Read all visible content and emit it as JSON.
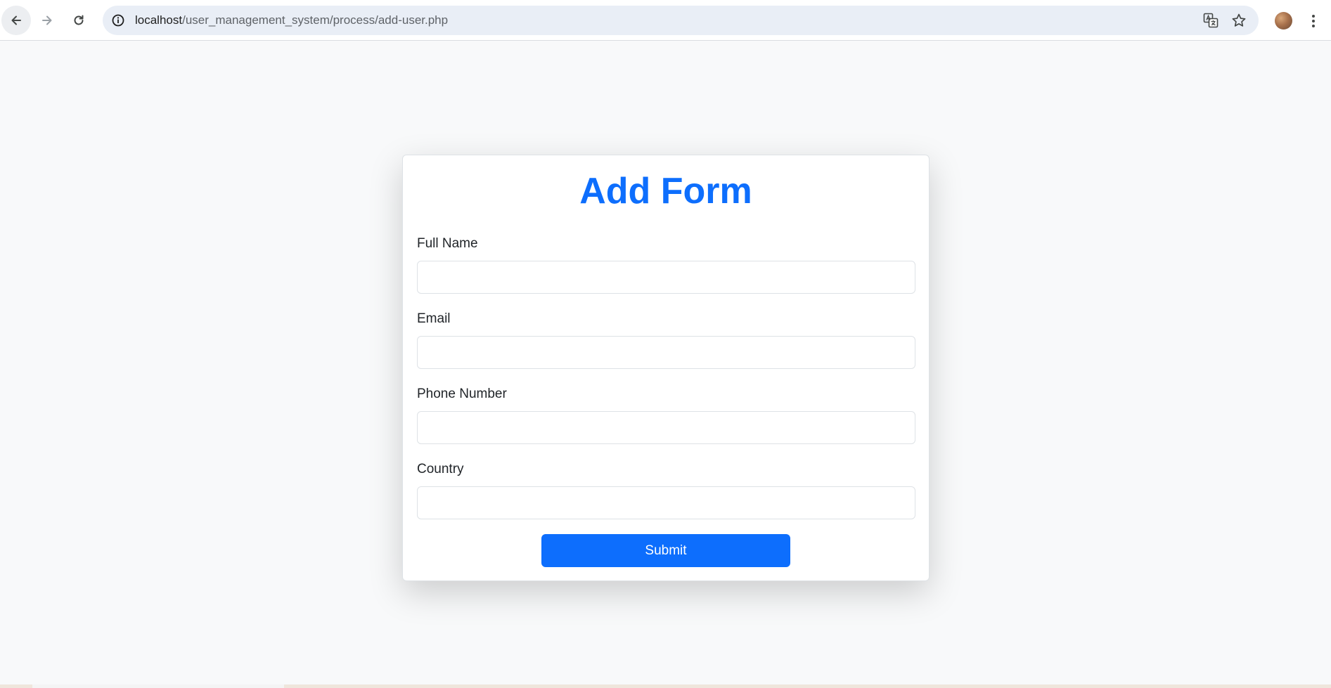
{
  "browser": {
    "url_host": "localhost",
    "url_path": "/user_management_system/process/add-user.php"
  },
  "form": {
    "title": "Add Form",
    "fields": [
      {
        "label": "Full Name",
        "value": "",
        "placeholder": ""
      },
      {
        "label": "Email",
        "value": "",
        "placeholder": ""
      },
      {
        "label": "Phone Number",
        "value": "",
        "placeholder": ""
      },
      {
        "label": "Country",
        "value": "",
        "placeholder": ""
      }
    ],
    "submit_label": "Submit"
  },
  "colors": {
    "accent": "#0d6efd",
    "page_background": "#f8f9fa"
  },
  "icons": [
    "back-arrow-icon",
    "forward-arrow-icon",
    "reload-icon",
    "info-icon",
    "translate-icon",
    "star-icon",
    "kebab-menu-icon"
  ]
}
